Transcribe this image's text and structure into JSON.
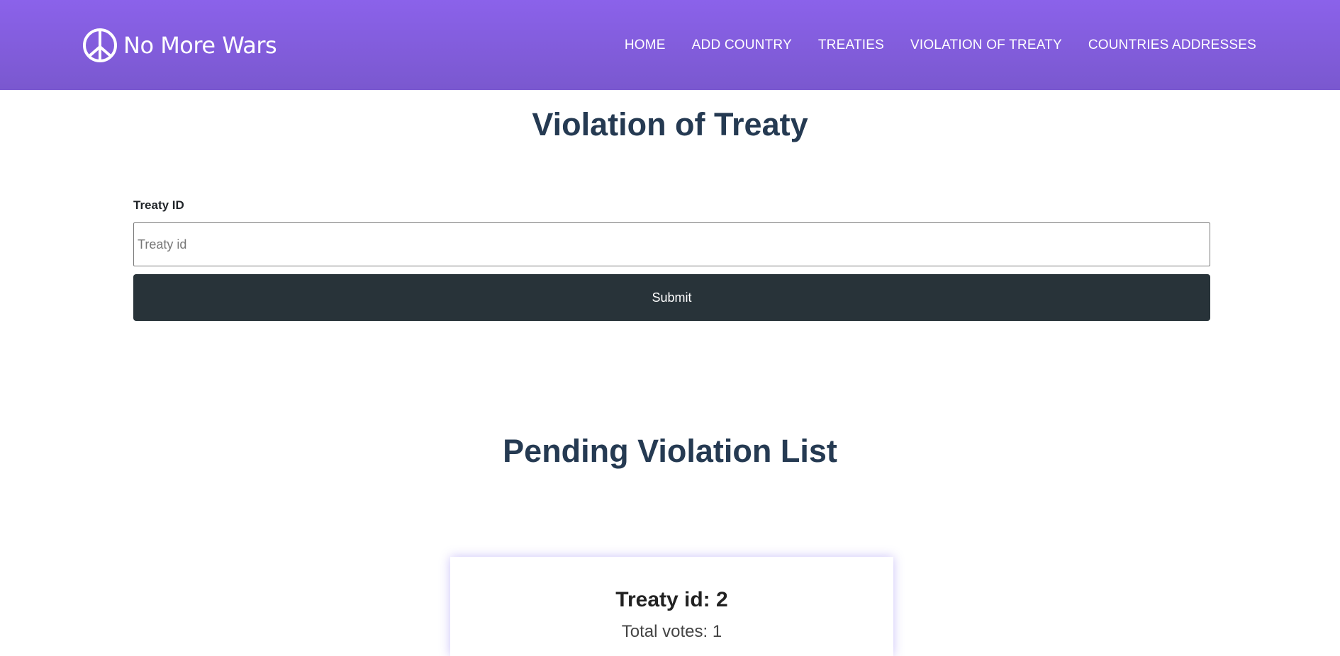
{
  "brand": {
    "name": "No More Wars",
    "icon": "peace-icon",
    "nav_color": "#8b62ea"
  },
  "nav": {
    "items": [
      {
        "label": "HOME"
      },
      {
        "label": "ADD COUNTRY"
      },
      {
        "label": "TREATIES"
      },
      {
        "label": "VIOLATION OF TREATY"
      },
      {
        "label": "COUNTRIES ADDRESSES"
      }
    ]
  },
  "violation_section": {
    "title": "Violation of Treaty",
    "field_label": "Treaty ID",
    "input_placeholder": "Treaty id",
    "input_value": "",
    "submit_label": "Submit",
    "button_color": "#283339"
  },
  "pending_section": {
    "title": "Pending Violation List",
    "cards": [
      {
        "title": "Treaty id: 2",
        "subtitle": "Total votes: 1"
      }
    ]
  }
}
